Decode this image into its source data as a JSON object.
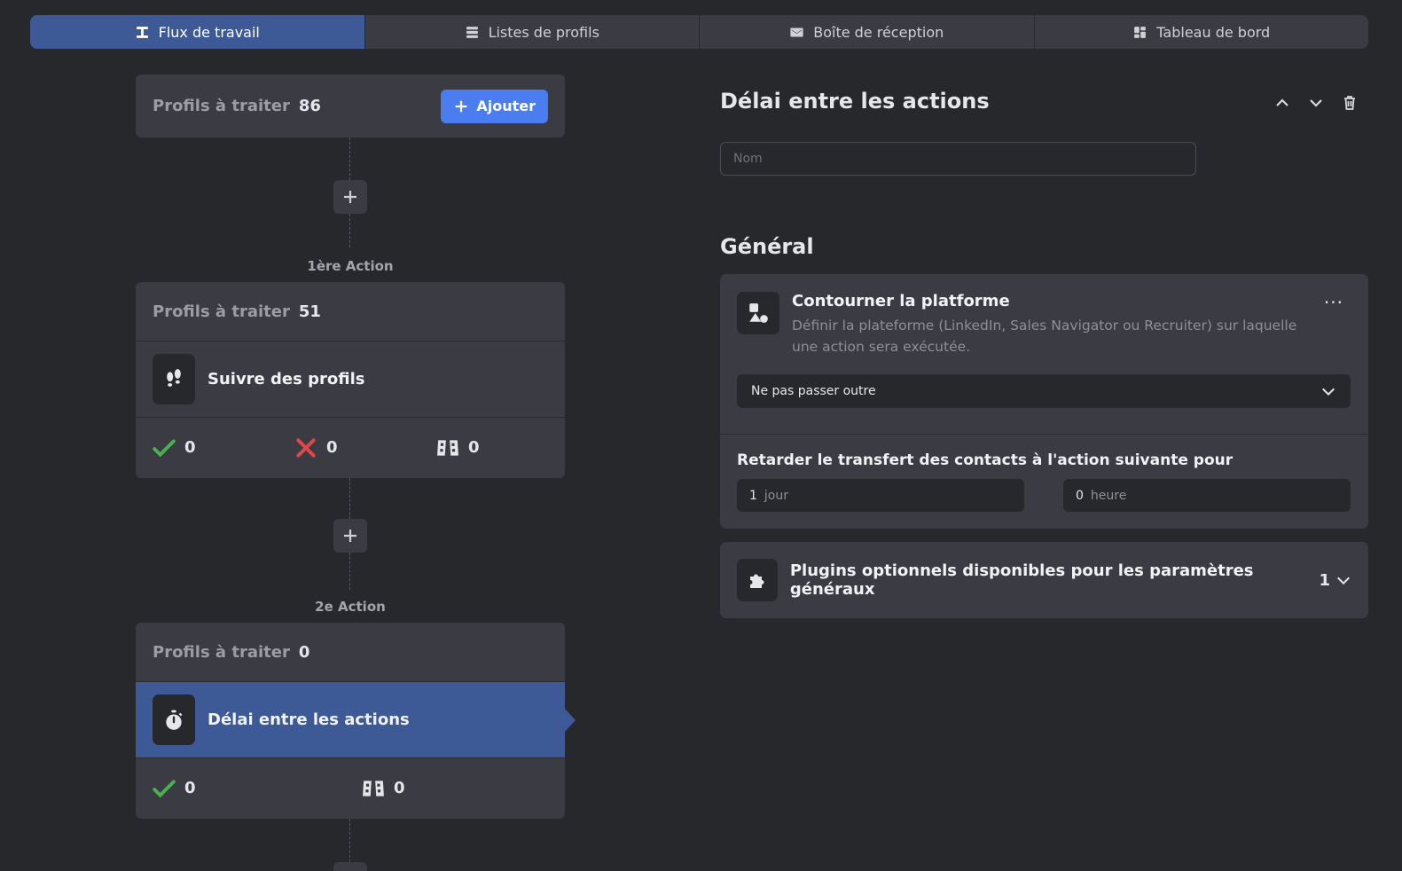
{
  "tabs": [
    {
      "label": "Flux de travail",
      "icon": "workflow-icon",
      "active": true
    },
    {
      "label": "Listes de profils",
      "icon": "list-icon",
      "active": false
    },
    {
      "label": "Boîte de réception",
      "icon": "mail-icon",
      "active": false
    },
    {
      "label": "Tableau de bord",
      "icon": "dashboard-icon",
      "active": false
    }
  ],
  "workflow": {
    "source": {
      "label": "Profils à traiter",
      "count": "86",
      "add_label": "Ajouter"
    },
    "steps": [
      {
        "step_label": "1ère Action",
        "pending_label": "Profils à traiter",
        "pending_count": "51",
        "title": "Suivre des profils",
        "icon": "footsteps-icon",
        "success": "0",
        "failed": "0",
        "skipped": "0"
      },
      {
        "step_label": "2e Action",
        "pending_label": "Profils à traiter",
        "pending_count": "0",
        "title": "Délai entre les actions",
        "icon": "stopwatch-icon",
        "success": "0",
        "skipped": "0",
        "selected": true
      }
    ]
  },
  "panel": {
    "title": "Délai entre les actions",
    "name_placeholder": "Nom",
    "name_value": "",
    "section_title": "Général",
    "platform": {
      "title": "Contourner la platforme",
      "description": "Définir la plateforme (LinkedIn, Sales Navigator ou Recruiter) sur laquelle une action sera exécutée.",
      "selected_option": "Ne pas passer outre",
      "more_label": "···"
    },
    "delay": {
      "title": "Retarder le transfert des contacts à l'action suivante pour",
      "days_value": "1",
      "days_unit": "jour",
      "hours_value": "0",
      "hours_unit": "heure"
    },
    "plugins": {
      "title": "Plugins optionnels disponibles pour les paramètres généraux",
      "count": "1"
    }
  },
  "colors": {
    "background": "#27282c",
    "card": "#3b3c43",
    "accent_active": "#3d5a96",
    "button_primary": "#4a7df0",
    "success": "#4caf50",
    "failure": "#e04848"
  }
}
